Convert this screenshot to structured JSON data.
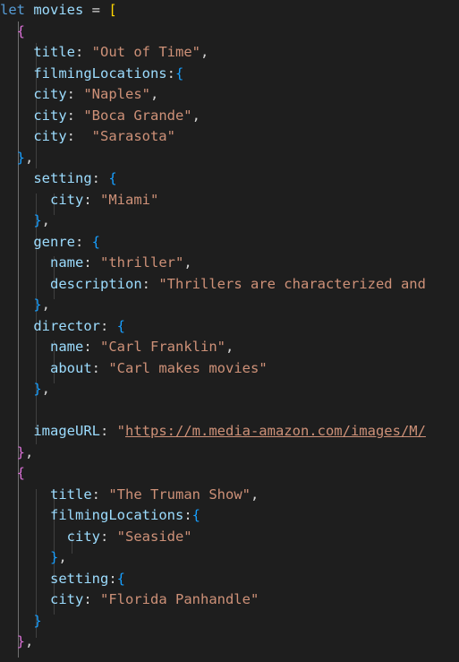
{
  "editor": {
    "colors": {
      "keyword": "#569cd6",
      "variable": "#9cdcfe",
      "property": "#9cdcfe",
      "string": "#ce9178",
      "punct": "#d4d4d4",
      "bracket1": "#ffd700",
      "bracket2": "#da70d6",
      "bracket3": "#179fff"
    },
    "lines": [
      {
        "tokens": [
          {
            "t": "let",
            "c": "keyword"
          },
          {
            "t": " ",
            "c": "punct"
          },
          {
            "t": "movies",
            "c": "variable"
          },
          {
            "t": " = ",
            "c": "punct"
          },
          {
            "t": "[",
            "c": "bracket1"
          }
        ]
      },
      {
        "tokens": [
          {
            "t": "  ",
            "c": "punct"
          },
          {
            "t": "{",
            "c": "bracket2"
          }
        ]
      },
      {
        "tokens": [
          {
            "t": "    ",
            "c": "punct"
          },
          {
            "t": "title",
            "c": "property"
          },
          {
            "t": ": ",
            "c": "punct"
          },
          {
            "t": "\"Out of Time\"",
            "c": "string"
          },
          {
            "t": ",",
            "c": "punct"
          }
        ]
      },
      {
        "tokens": [
          {
            "t": "    ",
            "c": "punct"
          },
          {
            "t": "filmingLocations",
            "c": "property"
          },
          {
            "t": ":",
            "c": "punct"
          },
          {
            "t": "{",
            "c": "bracket3"
          }
        ]
      },
      {
        "tokens": [
          {
            "t": "    ",
            "c": "punct"
          },
          {
            "t": "city",
            "c": "property"
          },
          {
            "t": ": ",
            "c": "punct"
          },
          {
            "t": "\"Naples\"",
            "c": "string"
          },
          {
            "t": ",",
            "c": "punct"
          }
        ]
      },
      {
        "tokens": [
          {
            "t": "    ",
            "c": "punct"
          },
          {
            "t": "city",
            "c": "property"
          },
          {
            "t": ": ",
            "c": "punct"
          },
          {
            "t": "\"Boca Grande\"",
            "c": "string"
          },
          {
            "t": ",",
            "c": "punct"
          }
        ]
      },
      {
        "tokens": [
          {
            "t": "    ",
            "c": "punct"
          },
          {
            "t": "city",
            "c": "property"
          },
          {
            "t": ":  ",
            "c": "punct"
          },
          {
            "t": "\"Sarasota\"",
            "c": "string"
          }
        ]
      },
      {
        "tokens": [
          {
            "t": "  ",
            "c": "punct"
          },
          {
            "t": "}",
            "c": "bracket3"
          },
          {
            "t": ",",
            "c": "punct"
          }
        ]
      },
      {
        "tokens": [
          {
            "t": "    ",
            "c": "punct"
          },
          {
            "t": "setting",
            "c": "property"
          },
          {
            "t": ": ",
            "c": "punct"
          },
          {
            "t": "{",
            "c": "bracket3"
          }
        ]
      },
      {
        "tokens": [
          {
            "t": "      ",
            "c": "punct"
          },
          {
            "t": "city",
            "c": "property"
          },
          {
            "t": ": ",
            "c": "punct"
          },
          {
            "t": "\"Miami\"",
            "c": "string"
          }
        ]
      },
      {
        "tokens": [
          {
            "t": "    ",
            "c": "punct"
          },
          {
            "t": "}",
            "c": "bracket3"
          },
          {
            "t": ",",
            "c": "punct"
          }
        ]
      },
      {
        "tokens": [
          {
            "t": "    ",
            "c": "punct"
          },
          {
            "t": "genre",
            "c": "property"
          },
          {
            "t": ": ",
            "c": "punct"
          },
          {
            "t": "{",
            "c": "bracket3"
          }
        ]
      },
      {
        "tokens": [
          {
            "t": "      ",
            "c": "punct"
          },
          {
            "t": "name",
            "c": "property"
          },
          {
            "t": ": ",
            "c": "punct"
          },
          {
            "t": "\"thriller\"",
            "c": "string"
          },
          {
            "t": ",",
            "c": "punct"
          }
        ]
      },
      {
        "tokens": [
          {
            "t": "      ",
            "c": "punct"
          },
          {
            "t": "description",
            "c": "property"
          },
          {
            "t": ": ",
            "c": "punct"
          },
          {
            "t": "\"Thrillers are characterized and",
            "c": "string"
          }
        ]
      },
      {
        "tokens": [
          {
            "t": "    ",
            "c": "punct"
          },
          {
            "t": "}",
            "c": "bracket3"
          },
          {
            "t": ",",
            "c": "punct"
          }
        ]
      },
      {
        "tokens": [
          {
            "t": "    ",
            "c": "punct"
          },
          {
            "t": "director",
            "c": "property"
          },
          {
            "t": ": ",
            "c": "punct"
          },
          {
            "t": "{",
            "c": "bracket3"
          }
        ]
      },
      {
        "tokens": [
          {
            "t": "      ",
            "c": "punct"
          },
          {
            "t": "name",
            "c": "property"
          },
          {
            "t": ": ",
            "c": "punct"
          },
          {
            "t": "\"Carl Franklin\"",
            "c": "string"
          },
          {
            "t": ",",
            "c": "punct"
          }
        ]
      },
      {
        "tokens": [
          {
            "t": "      ",
            "c": "punct"
          },
          {
            "t": "about",
            "c": "property"
          },
          {
            "t": ": ",
            "c": "punct"
          },
          {
            "t": "\"Carl makes movies\"",
            "c": "string"
          }
        ]
      },
      {
        "tokens": [
          {
            "t": "    ",
            "c": "punct"
          },
          {
            "t": "}",
            "c": "bracket3"
          },
          {
            "t": ",",
            "c": "punct"
          }
        ]
      },
      {
        "tokens": []
      },
      {
        "tokens": [
          {
            "t": "    ",
            "c": "punct"
          },
          {
            "t": "imageURL",
            "c": "property"
          },
          {
            "t": ": ",
            "c": "punct"
          },
          {
            "t": "\"",
            "c": "string"
          },
          {
            "t": "https://m.media-amazon.com/images/M/",
            "c": "string",
            "link": true
          }
        ]
      },
      {
        "tokens": [
          {
            "t": "  ",
            "c": "punct"
          },
          {
            "t": "}",
            "c": "bracket2"
          },
          {
            "t": ",",
            "c": "punct"
          }
        ]
      },
      {
        "tokens": [
          {
            "t": "  ",
            "c": "punct"
          },
          {
            "t": "{",
            "c": "bracket2"
          }
        ]
      },
      {
        "tokens": [
          {
            "t": "      ",
            "c": "punct"
          },
          {
            "t": "title",
            "c": "property"
          },
          {
            "t": ": ",
            "c": "punct"
          },
          {
            "t": "\"The Truman Show\"",
            "c": "string"
          },
          {
            "t": ",",
            "c": "punct"
          }
        ]
      },
      {
        "tokens": [
          {
            "t": "      ",
            "c": "punct"
          },
          {
            "t": "filmingLocations",
            "c": "property"
          },
          {
            "t": ":",
            "c": "punct"
          },
          {
            "t": "{",
            "c": "bracket3"
          }
        ]
      },
      {
        "tokens": [
          {
            "t": "        ",
            "c": "punct"
          },
          {
            "t": "city",
            "c": "property"
          },
          {
            "t": ": ",
            "c": "punct"
          },
          {
            "t": "\"Seaside\"",
            "c": "string"
          }
        ]
      },
      {
        "tokens": [
          {
            "t": "      ",
            "c": "punct"
          },
          {
            "t": "}",
            "c": "bracket3"
          },
          {
            "t": ",",
            "c": "punct"
          }
        ]
      },
      {
        "tokens": [
          {
            "t": "      ",
            "c": "punct"
          },
          {
            "t": "setting",
            "c": "property"
          },
          {
            "t": ":",
            "c": "punct"
          },
          {
            "t": "{",
            "c": "bracket3"
          }
        ]
      },
      {
        "tokens": [
          {
            "t": "      ",
            "c": "punct"
          },
          {
            "t": "city",
            "c": "property"
          },
          {
            "t": ": ",
            "c": "punct"
          },
          {
            "t": "\"Florida Panhandle\"",
            "c": "string"
          }
        ]
      },
      {
        "tokens": [
          {
            "t": "    ",
            "c": "punct"
          },
          {
            "t": "}",
            "c": "bracket3"
          }
        ]
      },
      {
        "tokens": [
          {
            "t": "  ",
            "c": "punct"
          },
          {
            "t": "}",
            "c": "bracket2"
          },
          {
            "t": ",",
            "c": "punct"
          }
        ]
      }
    ]
  }
}
